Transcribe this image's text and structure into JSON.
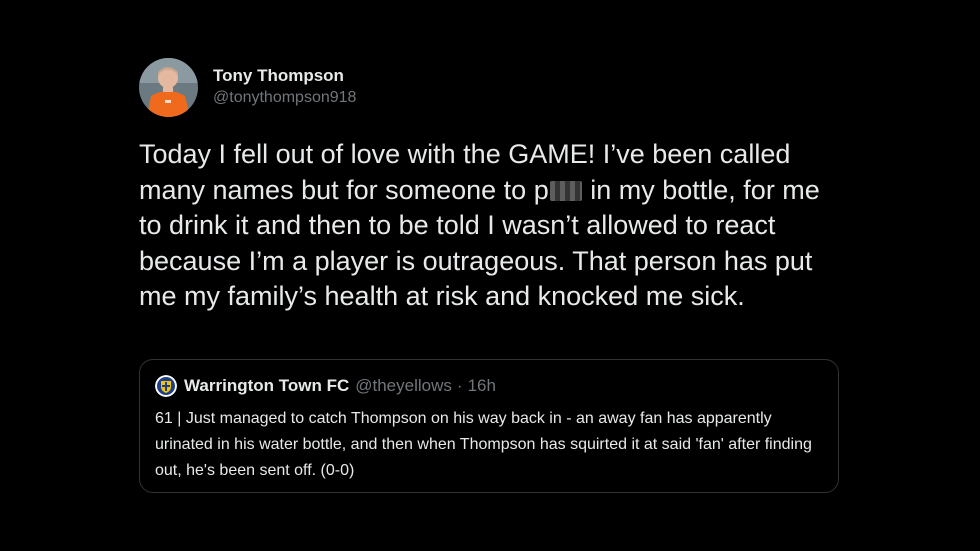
{
  "author": {
    "display_name": "Tony Thompson",
    "handle": "@tonythompson918",
    "avatar_icon": "player-avatar-icon"
  },
  "tweet": {
    "text_before_censor": "Today I fell out of love with the GAME! I’ve been called many names but for someone to p",
    "censored_icon": "censored-word-pixelation",
    "text_after_censor": " in my bottle, for me to drink it and then to be told I wasn’t allowed to react because I’m a player is outrageous. That person has put me my family’s health at risk and knocked me sick."
  },
  "quoted_tweet": {
    "display_name": "Warrington Town FC",
    "handle": "@theyellows",
    "separator": "·",
    "time": "16h",
    "logo_icon": "club-crest-icon",
    "text": "61 | Just managed to catch Thompson on his way back in - an away fan has apparently urinated in his water bottle, and then when Thompson has squirted it at said 'fan' after finding out, he's been sent off. (0-0)"
  },
  "colors": {
    "background": "#000000",
    "primary_text": "#e7e9ea",
    "secondary_text": "#71767b",
    "border": "#2f3336",
    "club_yellow": "#f5c400",
    "club_blue": "#1d3f8a"
  }
}
